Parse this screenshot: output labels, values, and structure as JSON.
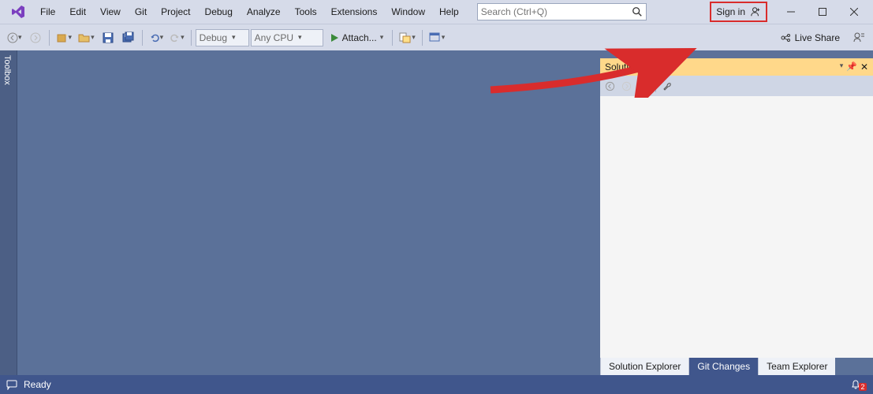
{
  "menu": [
    "File",
    "Edit",
    "View",
    "Git",
    "Project",
    "Debug",
    "Analyze",
    "Tools",
    "Extensions",
    "Window",
    "Help"
  ],
  "search": {
    "placeholder": "Search (Ctrl+Q)"
  },
  "signin": {
    "label": "Sign in"
  },
  "toolbar": {
    "config": "Debug",
    "platform": "Any CPU",
    "attach": "Attach..."
  },
  "liveshare": {
    "label": "Live Share"
  },
  "toolbox": {
    "label": "Toolbox"
  },
  "solutionExplorer": {
    "title": "Solution Explorer",
    "tabs": [
      "Solution Explorer",
      "Git Changes",
      "Team Explorer"
    ]
  },
  "status": {
    "ready": "Ready",
    "notifications": "2"
  }
}
